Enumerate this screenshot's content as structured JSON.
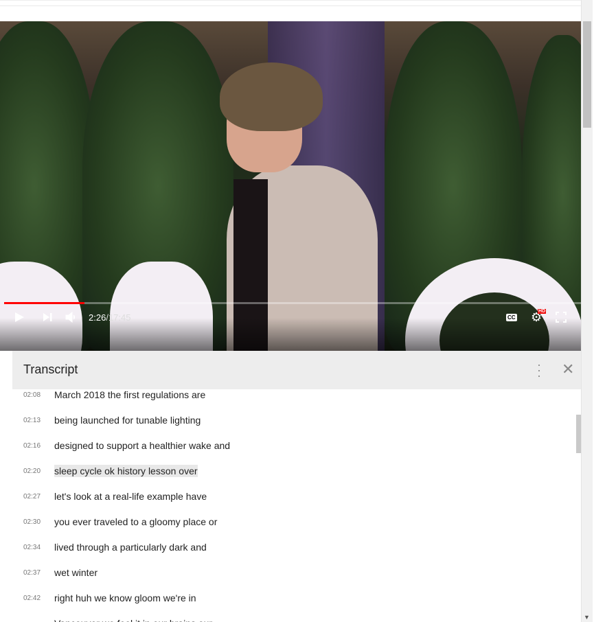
{
  "player": {
    "current_time": "2:26",
    "separator": " / ",
    "duration": "17:45",
    "progress_fraction": 0.137,
    "cc_label": "CC",
    "hd_badge": "HD"
  },
  "transcript": {
    "title": "Transcript",
    "lines": [
      {
        "time": "02:08",
        "text": "March 2018 the first regulations are"
      },
      {
        "time": "02:13",
        "text": "being launched for tunable lighting"
      },
      {
        "time": "02:16",
        "text": "designed to support a healthier wake and"
      },
      {
        "time": "02:20",
        "text": "sleep cycle ok history lesson over",
        "active": true
      },
      {
        "time": "02:27",
        "text": "let's look at a real-life example have"
      },
      {
        "time": "02:30",
        "text": "you ever traveled to a gloomy place or"
      },
      {
        "time": "02:34",
        "text": "lived through a particularly dark and"
      },
      {
        "time": "02:37",
        "text": "wet winter"
      },
      {
        "time": "02:42",
        "text": "right huh we know gloom we're in"
      },
      {
        "time": "",
        "text": "Vancouver we feel it in our brains our"
      }
    ]
  },
  "colors": {
    "progress": "#ff0000",
    "header_bg": "#ededed",
    "active_line_bg": "#e8e8e8"
  }
}
